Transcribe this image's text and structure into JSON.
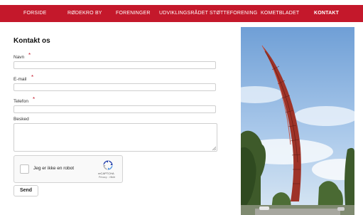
{
  "nav": {
    "items": [
      {
        "label": "FORSIDE"
      },
      {
        "label": "RØDEKRO BY"
      },
      {
        "label": "FORENINGER"
      },
      {
        "label": "UDVIKLINGSRÅDET"
      },
      {
        "label": "STØTTEFORENING"
      },
      {
        "label": "KOMETBLADET"
      },
      {
        "label": "KONTAKT"
      }
    ],
    "active": "KONTAKT"
  },
  "form": {
    "title": "Kontakt os",
    "required_mark": "*",
    "fields": [
      {
        "label": "Navn",
        "value": "",
        "required": true
      },
      {
        "label": "E-mail",
        "value": "",
        "required": true
      },
      {
        "label": "Telefon",
        "value": "",
        "required": true
      },
      {
        "label": "Besked",
        "value": "",
        "required": false
      }
    ],
    "captcha": {
      "label": "Jeg er ikke en robot",
      "brand": "reCAPTCHA",
      "links": "Privacy - Vilkår"
    },
    "submit_label": "Send"
  },
  "colors": {
    "nav_bg": "#c4182b",
    "required": "#c4182b"
  },
  "icons": [
    "recaptcha-logo-icon",
    "textarea-resize-icon"
  ]
}
